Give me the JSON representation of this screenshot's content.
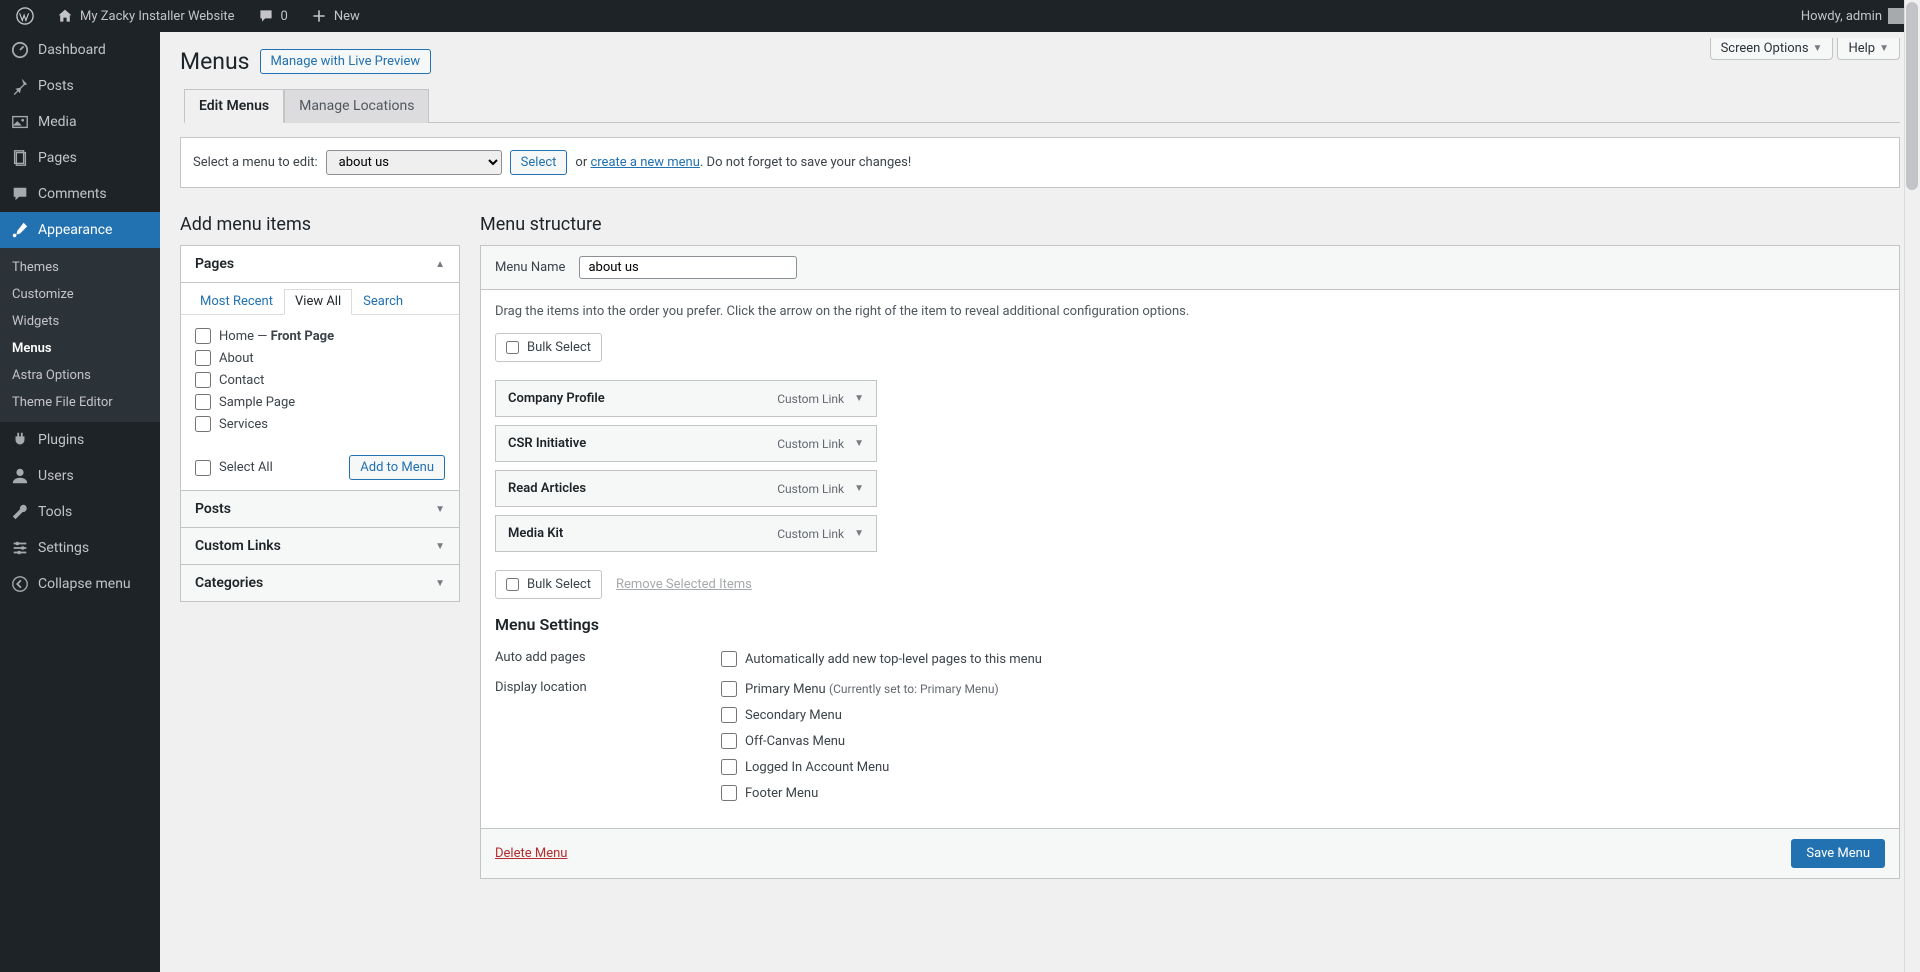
{
  "topbar": {
    "site_name": "My Zacky Installer Website",
    "comments_count": "0",
    "new_label": "New",
    "howdy": "Howdy, admin"
  },
  "sidebar": {
    "items": [
      {
        "label": "Dashboard"
      },
      {
        "label": "Posts"
      },
      {
        "label": "Media"
      },
      {
        "label": "Pages"
      },
      {
        "label": "Comments"
      },
      {
        "label": "Appearance"
      },
      {
        "label": "Plugins"
      },
      {
        "label": "Users"
      },
      {
        "label": "Tools"
      },
      {
        "label": "Settings"
      },
      {
        "label": "Collapse menu"
      }
    ],
    "appearance_sub": [
      {
        "label": "Themes"
      },
      {
        "label": "Customize"
      },
      {
        "label": "Widgets"
      },
      {
        "label": "Menus"
      },
      {
        "label": "Astra Options"
      },
      {
        "label": "Theme File Editor"
      }
    ]
  },
  "top_options": {
    "screen": "Screen Options",
    "help": "Help"
  },
  "page": {
    "title": "Menus",
    "live_preview": "Manage with Live Preview",
    "tabs": [
      "Edit Menus",
      "Manage Locations"
    ]
  },
  "select_row": {
    "label": "Select a menu to edit:",
    "selected": "about us",
    "select_btn": "Select",
    "or": "or",
    "create_link": "create a new menu",
    "reminder": ". Do not forget to save your changes!"
  },
  "add_items": {
    "heading": "Add menu items",
    "pages": {
      "title": "Pages",
      "tabs": [
        "Most Recent",
        "View All",
        "Search"
      ],
      "items": [
        {
          "label": "Home — ",
          "suffix": "Front Page"
        },
        {
          "label": "About"
        },
        {
          "label": "Contact"
        },
        {
          "label": "Sample Page"
        },
        {
          "label": "Services"
        }
      ],
      "select_all": "Select All",
      "add_btn": "Add to Menu"
    },
    "other_sections": [
      "Posts",
      "Custom Links",
      "Categories"
    ]
  },
  "structure": {
    "heading": "Menu structure",
    "menu_name_label": "Menu Name",
    "menu_name_value": "about us",
    "instructions": "Drag the items into the order you prefer. Click the arrow on the right of the item to reveal additional configuration options.",
    "bulk_select": "Bulk Select",
    "items": [
      {
        "title": "Company Profile",
        "type": "Custom Link"
      },
      {
        "title": "CSR Initiative",
        "type": "Custom Link"
      },
      {
        "title": "Read Articles",
        "type": "Custom Link"
      },
      {
        "title": "Media Kit",
        "type": "Custom Link"
      }
    ],
    "remove_selected": "Remove Selected Items"
  },
  "settings": {
    "heading": "Menu Settings",
    "auto_add_label": "Auto add pages",
    "auto_add_option": "Automatically add new top-level pages to this menu",
    "display_label": "Display location",
    "locations": [
      {
        "label": "Primary Menu",
        "hint": "(Currently set to: Primary Menu)"
      },
      {
        "label": "Secondary Menu"
      },
      {
        "label": "Off-Canvas Menu"
      },
      {
        "label": "Logged In Account Menu"
      },
      {
        "label": "Footer Menu"
      }
    ]
  },
  "footer": {
    "delete": "Delete Menu",
    "save": "Save Menu"
  }
}
